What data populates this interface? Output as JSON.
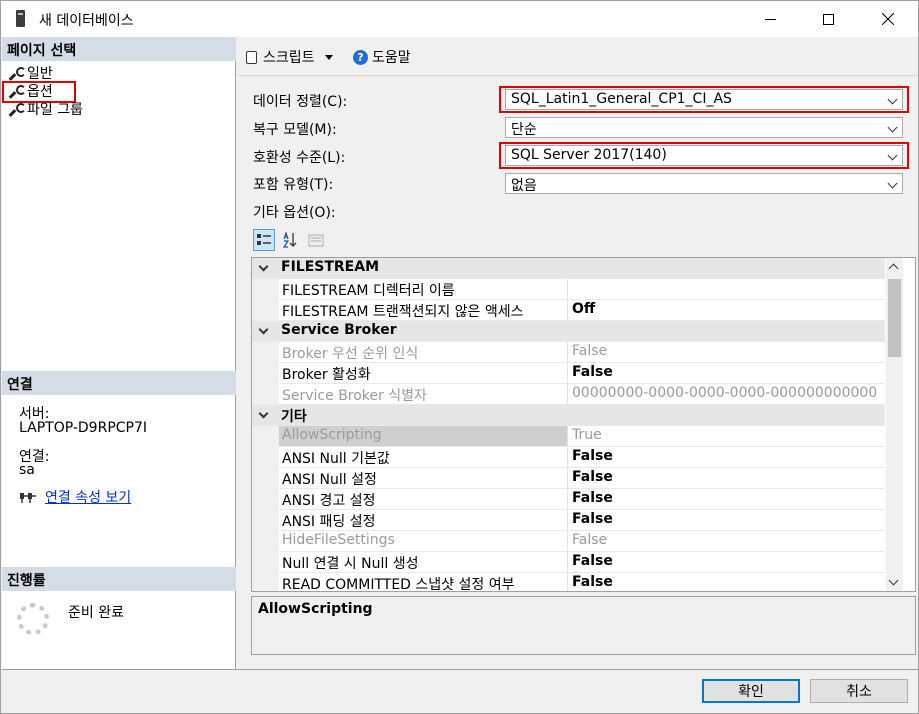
{
  "window": {
    "title": "새 데이터베이스"
  },
  "left": {
    "page_select_header": "페이지 선택",
    "nav_items": [
      "일반",
      "옵션",
      "파일 그룹"
    ],
    "connection_header": "연결",
    "server_label": "서버:",
    "server_value": "LAPTOP-D9RPCP7I",
    "connection_label": "연결:",
    "connection_value": "sa",
    "view_props_link": "연결 속성 보기",
    "progress_header": "진행률",
    "progress_status": "준비 완료"
  },
  "toolbar": {
    "script_label": "스크립트",
    "help_label": "도움말"
  },
  "form": {
    "collation_label": "데이터 정렬(C):",
    "collation_value": "SQL_Latin1_General_CP1_CI_AS",
    "recovery_label": "복구 모델(M):",
    "recovery_value": "단순",
    "compat_label": "호환성 수준(L):",
    "compat_value": "SQL Server 2017(140)",
    "containment_label": "포함 유형(T):",
    "containment_value": "없음",
    "other_options_label": "기타 옵션(O):"
  },
  "grid": {
    "rows": [
      {
        "type": "cat",
        "name": "FILESTREAM"
      },
      {
        "type": "prop",
        "name": "FILESTREAM 디렉터리 이름",
        "value": "",
        "dim": false,
        "bold": false
      },
      {
        "type": "prop",
        "name": "FILESTREAM 트랜잭션되지 않은 액세스",
        "value": "Off",
        "dim": false,
        "bold": true
      },
      {
        "type": "cat",
        "name": "Service Broker"
      },
      {
        "type": "prop",
        "name": "Broker 우선 순위 인식",
        "value": "False",
        "dim": true,
        "bold": false
      },
      {
        "type": "prop",
        "name": "Broker 활성화",
        "value": "False",
        "dim": false,
        "bold": true
      },
      {
        "type": "prop",
        "name": "Service Broker 식별자",
        "value": "00000000-0000-0000-0000-000000000000",
        "dim": true,
        "bold": false
      },
      {
        "type": "cat",
        "name": "기타"
      },
      {
        "type": "prop",
        "name": "AllowScripting",
        "value": "True",
        "dim": true,
        "bold": false,
        "selected": true
      },
      {
        "type": "prop",
        "name": "ANSI Null 기본값",
        "value": "False",
        "dim": false,
        "bold": true
      },
      {
        "type": "prop",
        "name": "ANSI Null 설정",
        "value": "False",
        "dim": false,
        "bold": true
      },
      {
        "type": "prop",
        "name": "ANSI 경고 설정",
        "value": "False",
        "dim": false,
        "bold": true
      },
      {
        "type": "prop",
        "name": "ANSI 패딩 설정",
        "value": "False",
        "dim": false,
        "bold": true
      },
      {
        "type": "prop",
        "name": "HideFileSettings",
        "value": "False",
        "dim": true,
        "bold": false
      },
      {
        "type": "prop",
        "name": "Null 연결 시 Null 생성",
        "value": "False",
        "dim": false,
        "bold": true
      },
      {
        "type": "prop",
        "name": "READ COMMITTED 스냅샷 설정 여부",
        "value": "False",
        "dim": false,
        "bold": true
      }
    ],
    "description": "AllowScripting"
  },
  "buttons": {
    "ok": "확인",
    "cancel": "취소"
  }
}
